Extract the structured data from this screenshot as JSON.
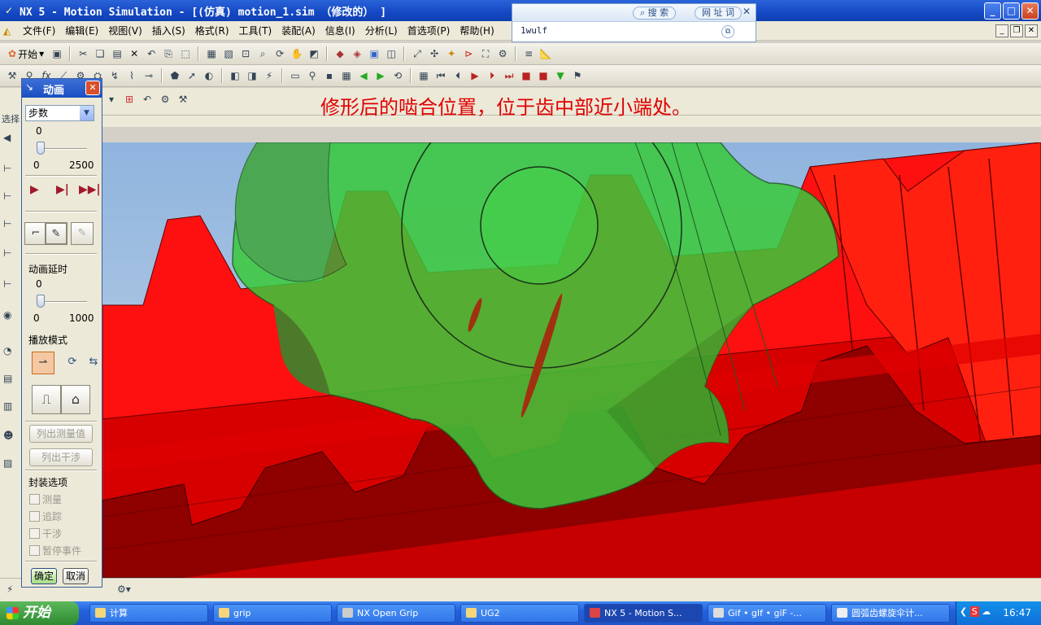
{
  "window": {
    "title": "NX 5 - Motion Simulation - [(仿真) motion_1.sim （修改的） ]",
    "buttons": [
      "_",
      "□",
      "✕"
    ]
  },
  "search_popup": {
    "search_label": "搜 索",
    "url_label": "网 址",
    "word_label": "词",
    "text": "1wulf"
  },
  "menu": {
    "items": [
      "文件(F)",
      "编辑(E)",
      "视图(V)",
      "插入(S)",
      "格式(R)",
      "工具(T)",
      "装配(A)",
      "信息(I)",
      "分析(L)",
      "首选项(P)",
      "帮助(H)"
    ]
  },
  "toolbar": {
    "start_label": "开始"
  },
  "annotation": {
    "text": "修形后的啮合位置，位于齿中部近小端处。"
  },
  "left_strip": {
    "select_label": "选择"
  },
  "dialog": {
    "title": "动画",
    "mode_select": "步数",
    "step_slider": {
      "value": "0",
      "min": "0",
      "max": "2500",
      "level": 0
    },
    "delay_label": "动画延时",
    "delay_slider": {
      "value": "0",
      "min": "0",
      "max": "1000",
      "level": 0
    },
    "play_mode_label": "播放模式",
    "list_measure_button": "列出测量值",
    "list_interference_button": "列出干涉",
    "capture_label": "封装选项",
    "checkboxes": [
      "测量",
      "追踪",
      "干涉",
      "暂停事件"
    ],
    "ok_button": "确定",
    "cancel_button": "取消"
  },
  "taskbar": {
    "start_label": "开始",
    "tasks": [
      "计算",
      "grip",
      "NX Open Grip",
      "UG2",
      "NX 5 - Motion S...",
      "Gif • gIf • giF -...",
      "圆弧齿螺旋伞计..."
    ],
    "clock": "16:47"
  },
  "colors": {
    "gear_green": "#39c93a",
    "rack_red": "#ff1010",
    "annotation_red": "#e00000",
    "titlebar_blue": "#1548c4"
  }
}
